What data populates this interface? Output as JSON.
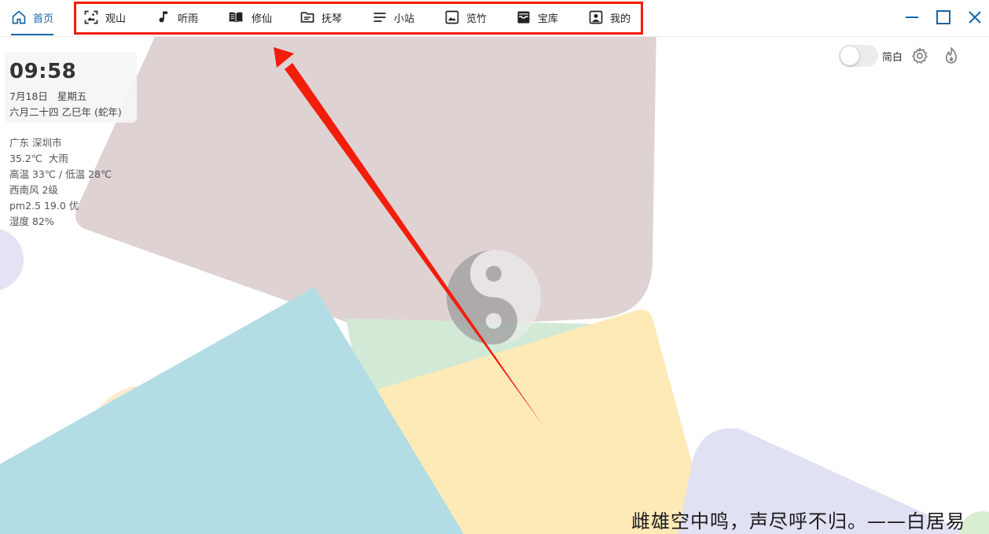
{
  "nav": {
    "home_label": "首页",
    "items": [
      {
        "label": "观山",
        "icon": "mountain-image-icon"
      },
      {
        "label": "听雨",
        "icon": "music-note-icon"
      },
      {
        "label": "修仙",
        "icon": "open-book-icon"
      },
      {
        "label": "抚琴",
        "icon": "folder-list-icon"
      },
      {
        "label": "小站",
        "icon": "text-lines-icon"
      },
      {
        "label": "览竹",
        "icon": "image-icon"
      },
      {
        "label": "宝库",
        "icon": "inbox-tray-icon"
      },
      {
        "label": "我的",
        "icon": "user-portrait-icon"
      }
    ],
    "accent_color": "#1565a8",
    "annotation_color": "#f21d0b"
  },
  "clock": {
    "time": "09:58",
    "date": "7月18日",
    "weekday": "星期五",
    "lunar": "六月二十四 乙巳年 (蛇年)"
  },
  "weather": {
    "location": "广东 深圳市",
    "current": "35.2℃  大雨",
    "range": "高温 33℃ / 低温 28℃",
    "wind": "西南风 2级",
    "air": "pm2.5 19.0 优",
    "humidity": "湿度 82%"
  },
  "controls": {
    "toggle_label": "简白",
    "toggle_on": false
  },
  "quote": "雌雄空中鸣，声尽呼不归。——白居易"
}
